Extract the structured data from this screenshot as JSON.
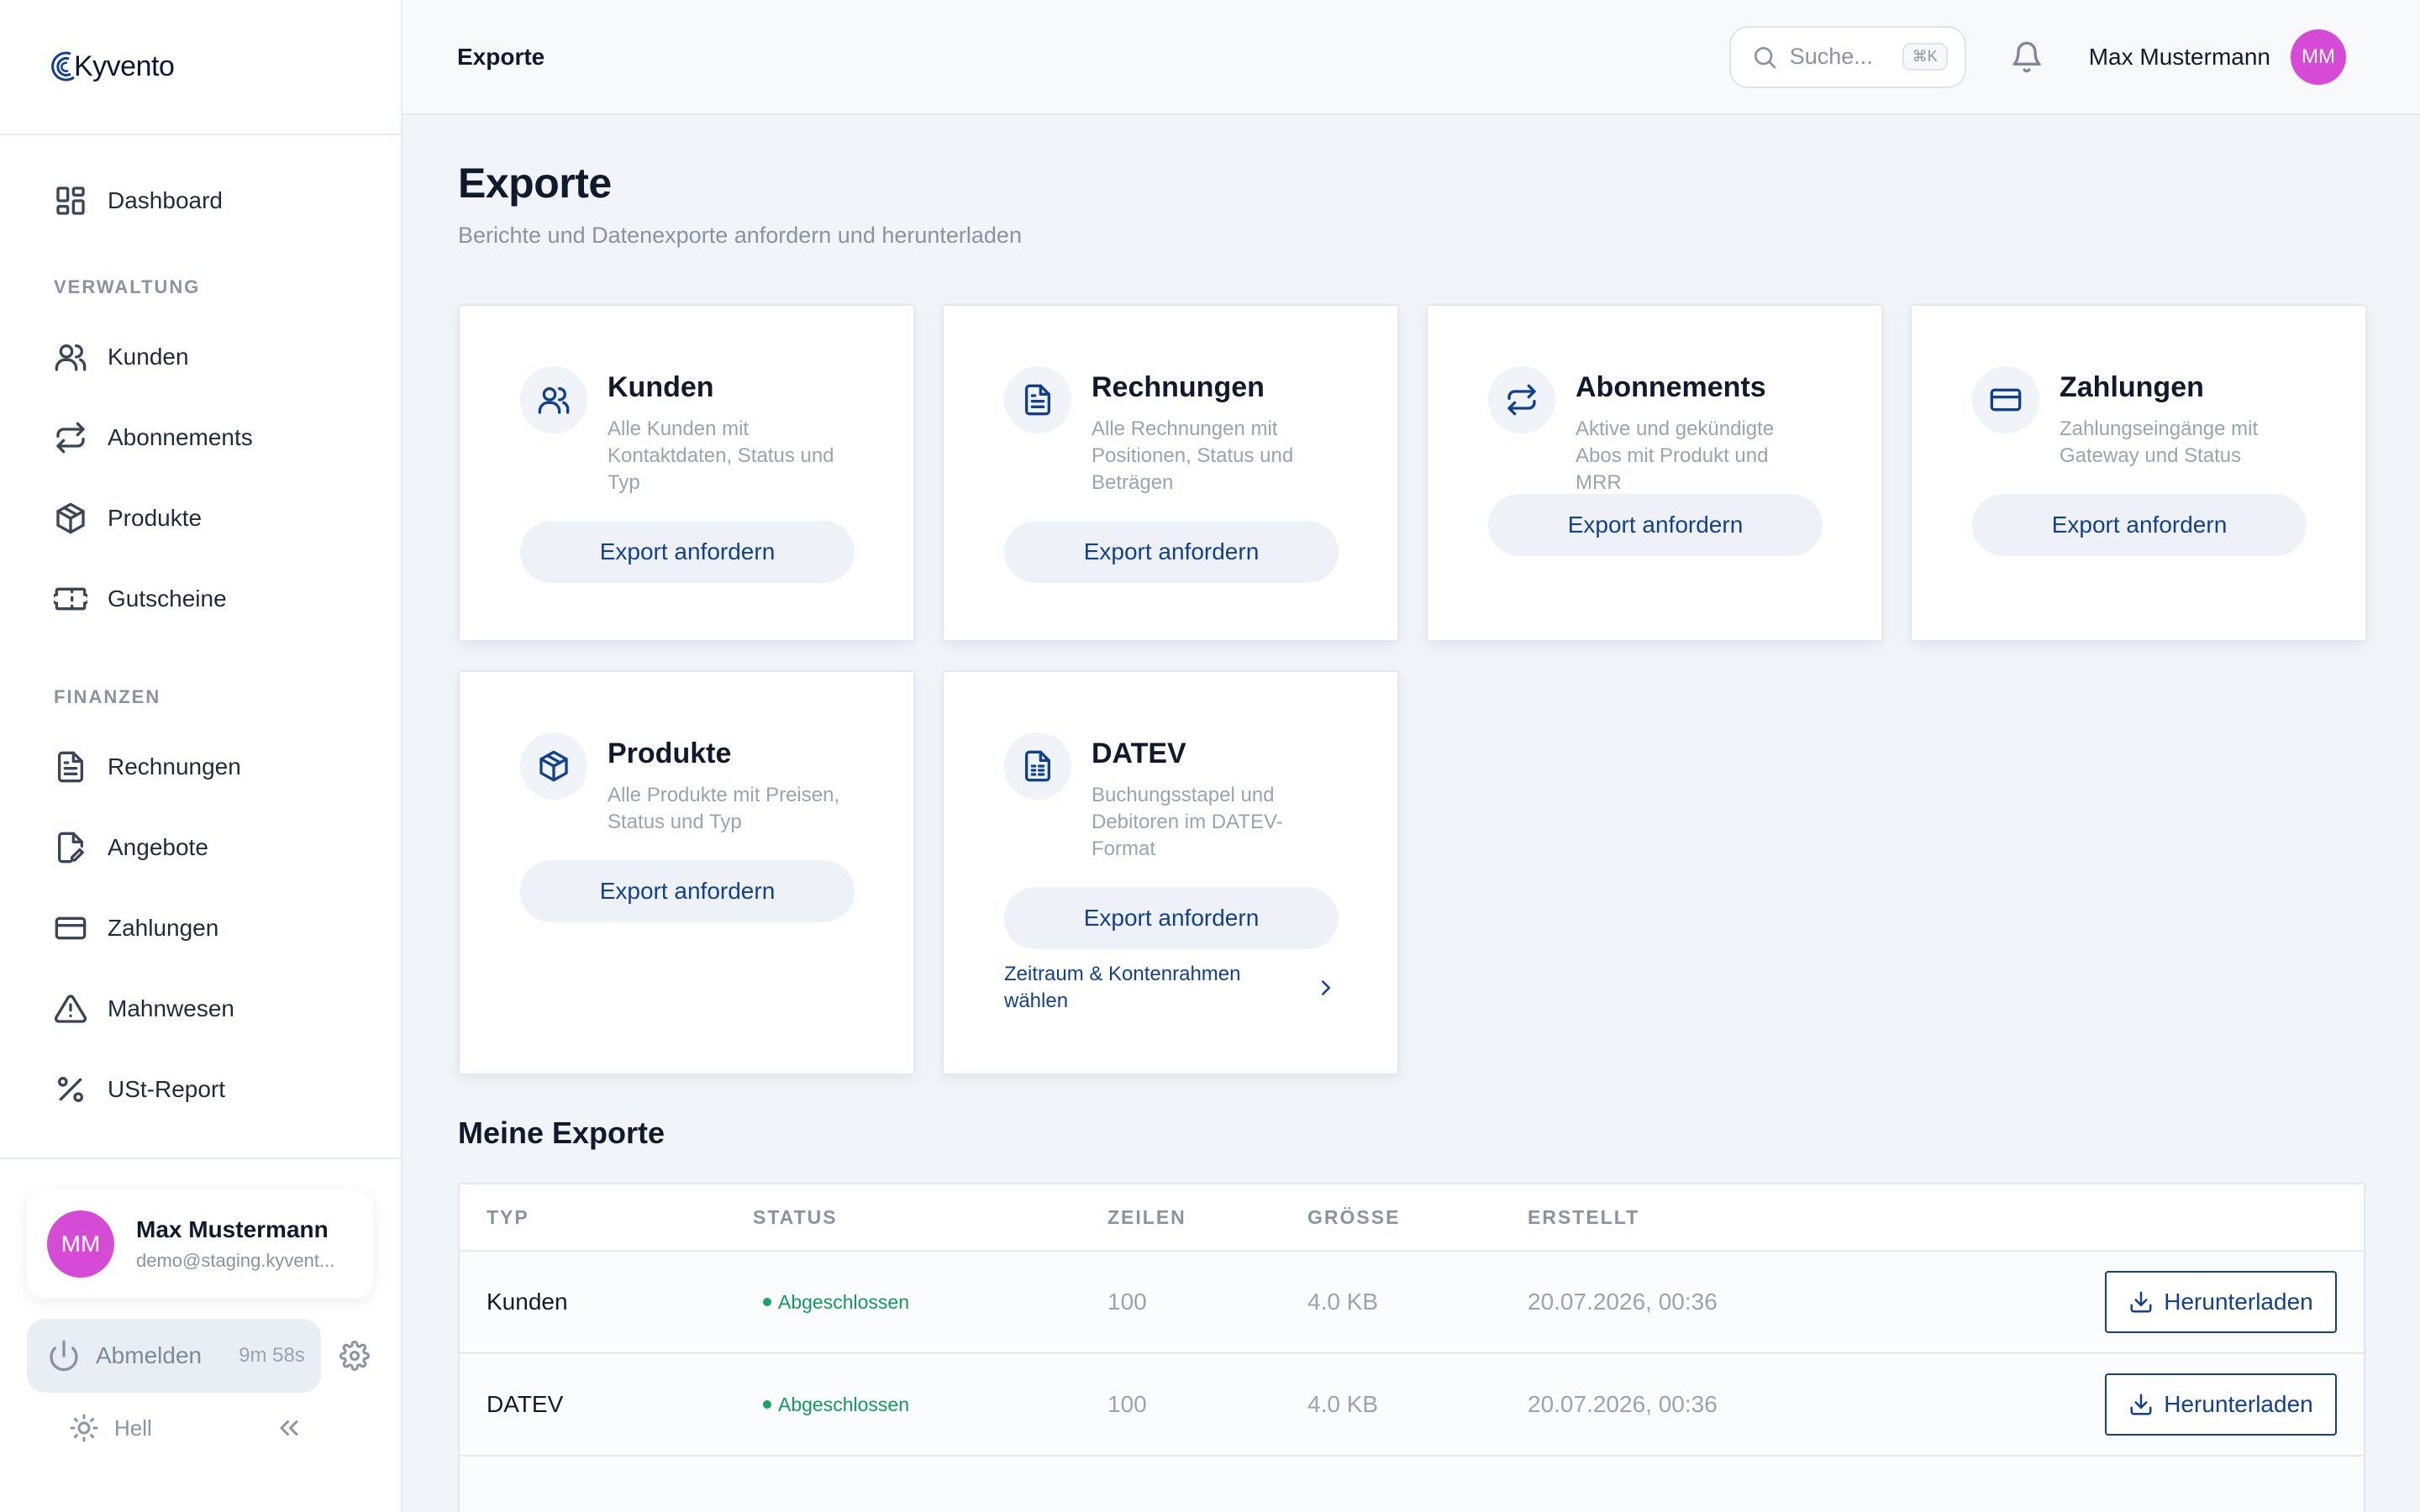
{
  "brand": {
    "name": "Kyvento",
    "accent": "#11408f",
    "avatar_color": "#d64bd6"
  },
  "sidebar": {
    "dashboard": "Dashboard",
    "sections": [
      {
        "title": "VERWALTUNG",
        "items": [
          {
            "label": "Kunden",
            "icon": "users-icon"
          },
          {
            "label": "Abonnements",
            "icon": "repeat-icon"
          },
          {
            "label": "Produkte",
            "icon": "box-icon"
          },
          {
            "label": "Gutscheine",
            "icon": "ticket-icon"
          }
        ]
      },
      {
        "title": "FINANZEN",
        "items": [
          {
            "label": "Rechnungen",
            "icon": "file-text-icon"
          },
          {
            "label": "Angebote",
            "icon": "file-edit-icon"
          },
          {
            "label": "Zahlungen",
            "icon": "credit-card-icon"
          },
          {
            "label": "Mahnwesen",
            "icon": "alert-triangle-icon"
          },
          {
            "label": "USt-Report",
            "icon": "percent-icon"
          }
        ]
      }
    ],
    "user": {
      "initials": "MM",
      "name": "Max Mustermann",
      "email": "demo@staging.kyvent..."
    },
    "logout": {
      "label": "Abmelden",
      "timer": "9m 58s"
    },
    "theme": {
      "label": "Hell"
    }
  },
  "topbar": {
    "title": "Exporte",
    "search_placeholder": "Suche...",
    "search_shortcut": "⌘K",
    "user_name": "Max Mustermann",
    "user_initials": "MM"
  },
  "page": {
    "title": "Exporte",
    "subtitle": "Berichte und Datenexporte anfordern und herunterladen"
  },
  "export_cards": [
    {
      "title": "Kunden",
      "description": "Alle Kunden mit Kontaktdaten, Status und Typ",
      "button": "Export anfordern",
      "icon": "users-icon"
    },
    {
      "title": "Rechnungen",
      "description": "Alle Rechnungen mit Positionen, Status und Beträgen",
      "button": "Export anfordern",
      "icon": "file-text-icon"
    },
    {
      "title": "Abonnements",
      "description": "Aktive und gekündigte Abos mit Produkt und MRR",
      "button": "Export anfordern",
      "icon": "repeat-icon"
    },
    {
      "title": "Zahlungen",
      "description": "Zahlungseingänge mit Gateway und Status",
      "button": "Export anfordern",
      "icon": "credit-card-icon"
    },
    {
      "title": "Produkte",
      "description": "Alle Produkte mit Preisen, Status und Typ",
      "button": "Export anfordern",
      "icon": "box-icon"
    },
    {
      "title": "DATEV",
      "description": "Buchungsstapel und Debitoren im DATEV-Format",
      "button": "Export anfordern",
      "icon": "file-spreadsheet-icon",
      "link": "Zeitraum & Kontenrahmen wählen"
    }
  ],
  "my_exports": {
    "title": "Meine Exporte",
    "columns": [
      "TYP",
      "STATUS",
      "ZEILEN",
      "GRÖSSE",
      "ERSTELLT"
    ],
    "rows": [
      {
        "type": "Kunden",
        "status": "Abgeschlossen",
        "rows": "100",
        "size": "4.0 KB",
        "created": "20.07.2026, 00:36",
        "action": "Herunterladen"
      },
      {
        "type": "DATEV",
        "status": "Abgeschlossen",
        "rows": "100",
        "size": "4.0 KB",
        "created": "20.07.2026, 00:36",
        "action": "Herunterladen"
      }
    ],
    "status_color": "#129a5c"
  }
}
